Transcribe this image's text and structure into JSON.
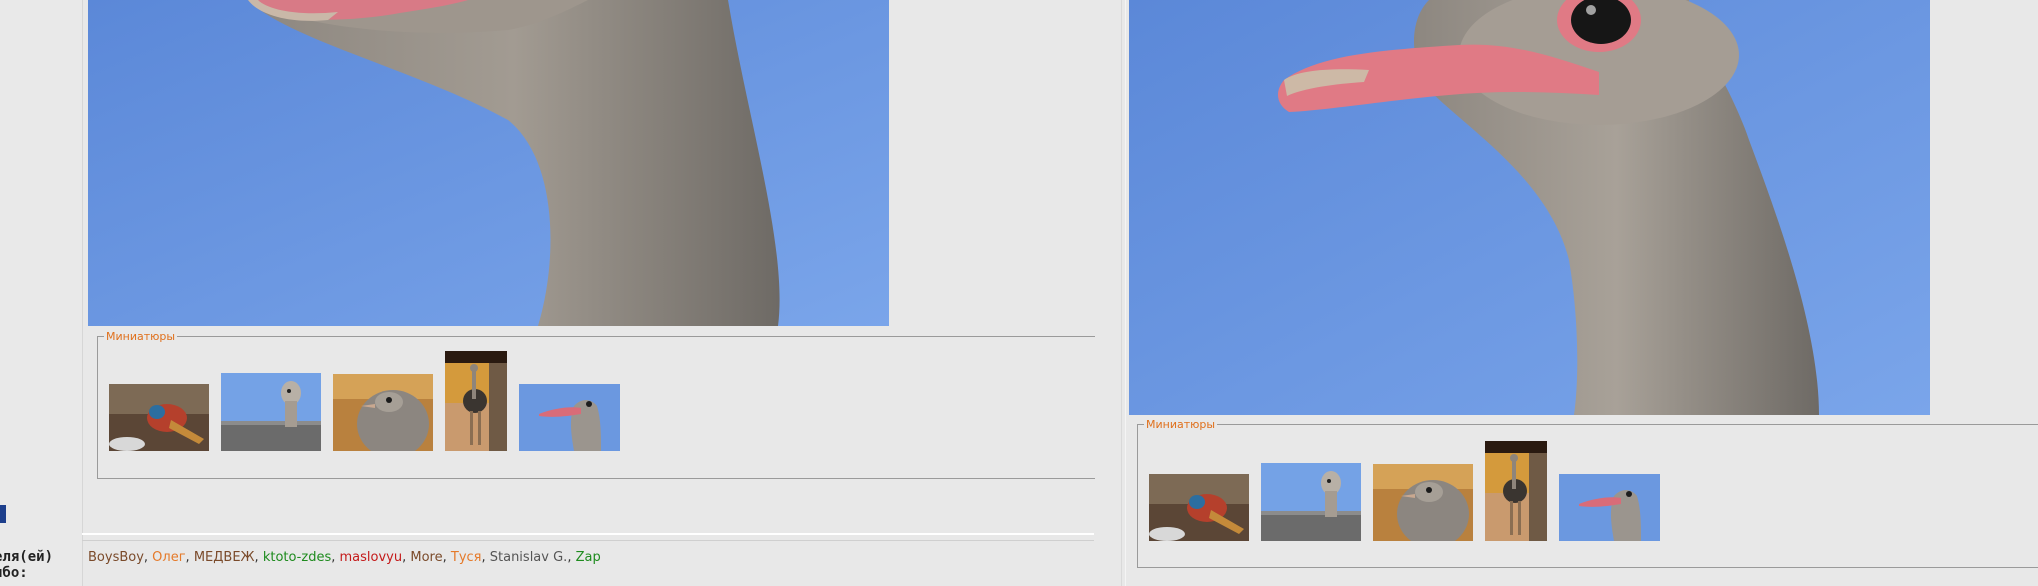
{
  "gallery_legend": "Миниатюры",
  "left_label_line1": "еля(ей)",
  "left_label_line2": "ибо:",
  "thanks_users": [
    {
      "name": "BoysBoy",
      "color": "#7a4a2a"
    },
    {
      "name": "Олег",
      "color": "#e57a2a"
    },
    {
      "name": "МЕДВЕЖ",
      "color": "#7a4a2a"
    },
    {
      "name": "ktoto-zdes",
      "color": "#1e8b1e"
    },
    {
      "name": "maslovyu",
      "color": "#c41a1a"
    },
    {
      "name": "More",
      "color": "#7a4a2a"
    },
    {
      "name": "Туся",
      "color": "#e57a2a"
    },
    {
      "name": "Stanislav G.",
      "color": "#555555"
    },
    {
      "name": "Zap",
      "color": "#1e8b1e"
    }
  ],
  "separator": ", ",
  "thumbnails": [
    {
      "name": "thumb-pheasant",
      "subject": "pheasant"
    },
    {
      "name": "thumb-ostrich-far",
      "subject": "ostrich head over fence"
    },
    {
      "name": "thumb-ostrich-close",
      "subject": "ostrich closeup"
    },
    {
      "name": "thumb-ostrich-standing",
      "subject": "standing ostrich"
    },
    {
      "name": "thumb-ostrich-head",
      "subject": "ostrich head on sky"
    }
  ]
}
